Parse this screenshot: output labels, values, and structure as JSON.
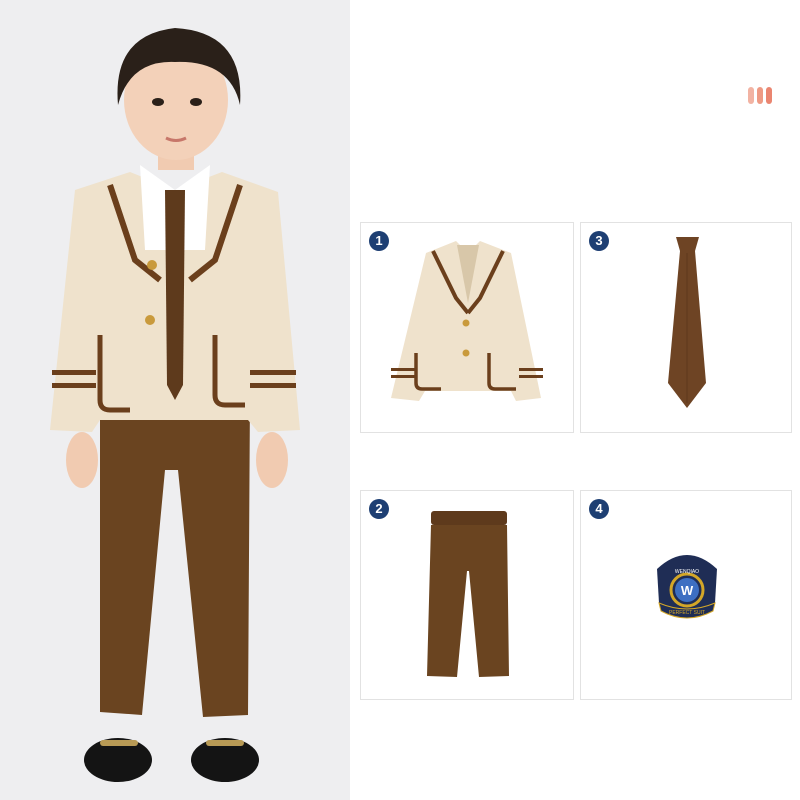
{
  "colors": {
    "badge": "#1e3f73",
    "accent_bars": [
      "#f2b3a3",
      "#ee9a84",
      "#ea8570"
    ],
    "jacket": "#efe2cc",
    "trim": "#6b3f1c",
    "pants": "#6a4420",
    "tie": "#6e4424",
    "emblem_navy": "#1f2d55",
    "emblem_gold": "#d3a628"
  },
  "items": [
    {
      "number": "1",
      "name": "blazer"
    },
    {
      "number": "3",
      "name": "tie"
    },
    {
      "number": "2",
      "name": "pants"
    },
    {
      "number": "4",
      "name": "badge"
    }
  ],
  "emblem": {
    "top_text": "WENQIAO",
    "letter": "W",
    "ribbon_text": "PERFECT SUIT"
  }
}
